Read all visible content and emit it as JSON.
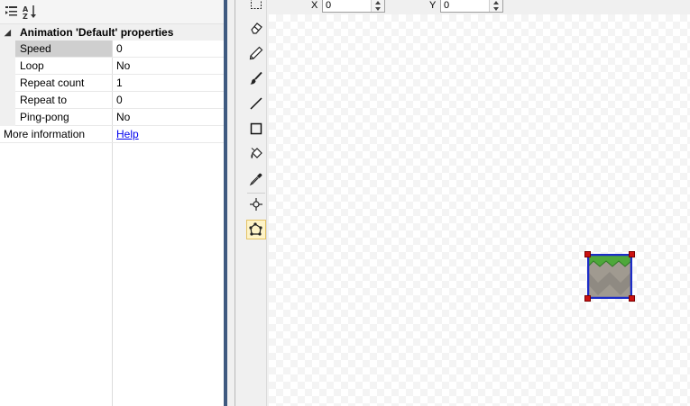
{
  "property_grid": {
    "toolbar": {
      "categorized_icon": "categorized-icon",
      "alphabetical_icon": "sort-az-icon"
    },
    "section": {
      "title": "Animation 'Default' properties",
      "expander_glyph": "◢"
    },
    "properties": [
      {
        "name": "Speed",
        "value": "0"
      },
      {
        "name": "Loop",
        "value": "No"
      },
      {
        "name": "Repeat count",
        "value": "1"
      },
      {
        "name": "Repeat to",
        "value": "0"
      },
      {
        "name": "Ping-pong",
        "value": "No"
      }
    ],
    "more_info": {
      "label": "More information",
      "link": "Help"
    }
  },
  "tools": [
    {
      "name": "select-tool",
      "icon": "marquee-icon"
    },
    {
      "name": "eraser-tool",
      "icon": "eraser-icon"
    },
    {
      "name": "pencil-tool",
      "icon": "pencil-icon"
    },
    {
      "name": "brush-tool",
      "icon": "brush-icon"
    },
    {
      "name": "line-tool",
      "icon": "line-icon"
    },
    {
      "name": "rectangle-tool",
      "icon": "rectangle-icon"
    },
    {
      "name": "fill-tool",
      "icon": "paint-bucket-icon"
    },
    {
      "name": "color-picker-tool",
      "icon": "eyedropper-icon"
    },
    {
      "name": "origin-tool",
      "icon": "crosshair-icon"
    },
    {
      "name": "collision-polygon-tool",
      "icon": "polygon-icon",
      "active": true
    }
  ],
  "coords": {
    "x_label": "X",
    "x_value": "0",
    "y_label": "Y",
    "y_value": "0"
  },
  "colors": {
    "splitter": "#3f5a80",
    "polygon_border": "#1c2cc8",
    "handle": "#cc1111",
    "active_tool": "#fdf3c7"
  }
}
